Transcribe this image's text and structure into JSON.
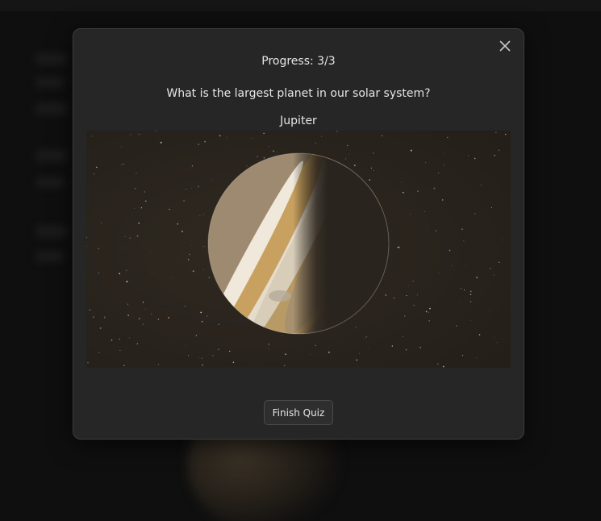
{
  "quiz": {
    "progress_text": "Progress: 3/3",
    "question": "What is the largest planet in our solar system?",
    "answer": "Jupiter",
    "finish_label": "Finish Quiz",
    "image_subject": "jupiter-planet-image"
  },
  "icons": {
    "close": "close-icon"
  },
  "colors": {
    "modal_bg": "#262626",
    "backdrop": "#0f0f0f",
    "text": "#e6e6e6",
    "button_bg": "#2e2e2e"
  }
}
